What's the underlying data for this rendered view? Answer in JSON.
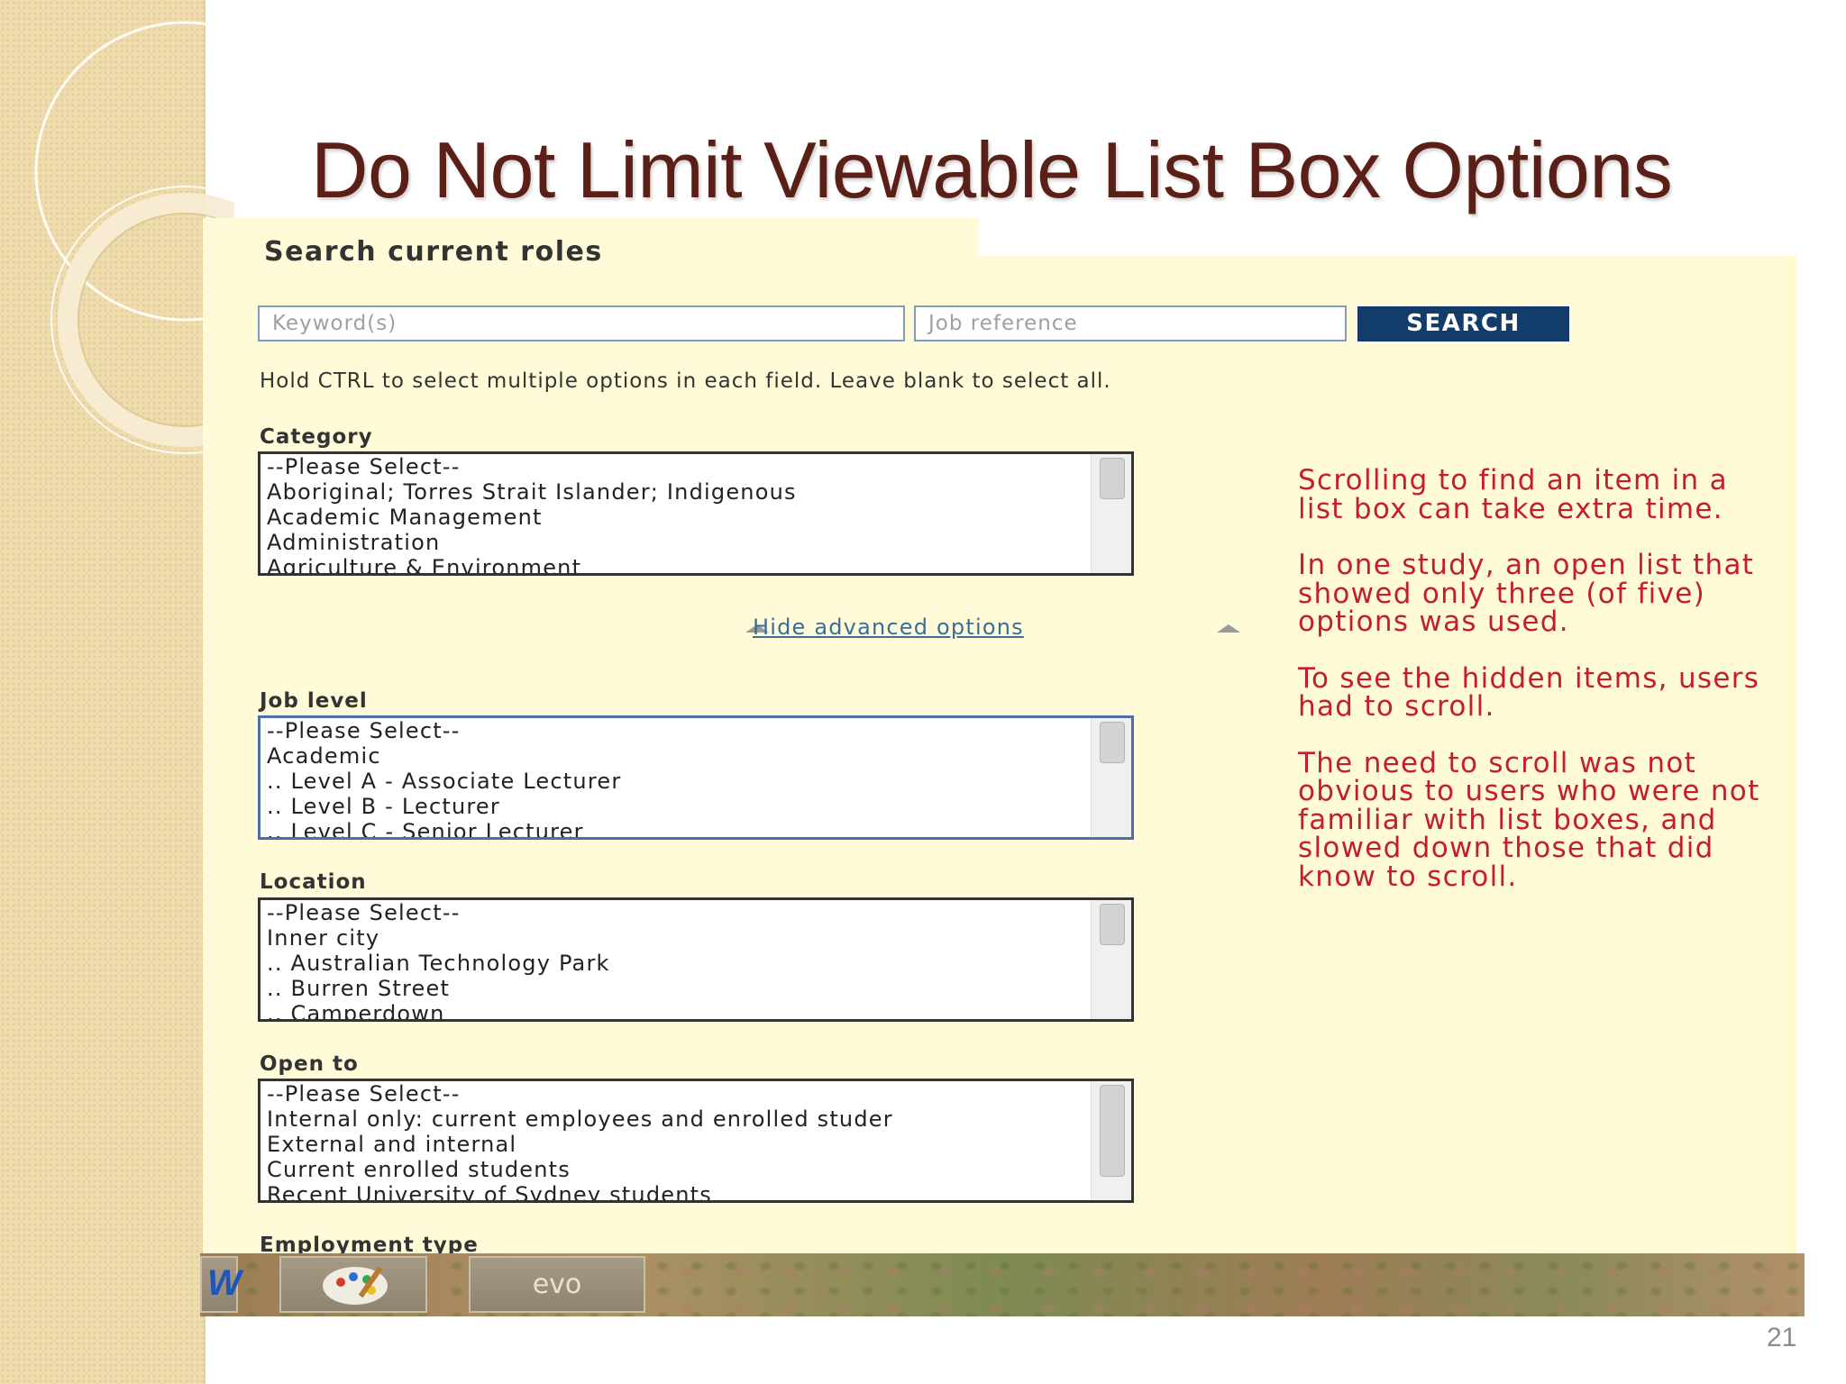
{
  "slide": {
    "title": "Do Not Limit Viewable List Box Options",
    "page_number": "21"
  },
  "form": {
    "heading": "Search current roles",
    "keyword_placeholder": "Keyword(s)",
    "job_reference_placeholder": "Job reference",
    "search_button_label": "SEARCH",
    "hint": "Hold CTRL to select multiple options in each field. Leave blank to select all.",
    "hide_advanced_label": "Hide advanced options",
    "fields": {
      "category": {
        "label": "Category",
        "options": [
          "--Please Select--",
          "Aboriginal; Torres Strait Islander; Indigenous",
          "Academic Management",
          "Administration",
          "Agriculture & Environment"
        ]
      },
      "job_level": {
        "label": "Job level",
        "options": [
          "--Please Select--",
          "Academic",
          ".. Level A - Associate Lecturer",
          ".. Level B - Lecturer",
          ".. Level C - Senior Lecturer"
        ]
      },
      "location": {
        "label": "Location",
        "options": [
          "--Please Select--",
          "Inner city",
          ".. Australian Technology Park",
          ".. Burren Street",
          ".. Camperdown"
        ]
      },
      "open_to": {
        "label": "Open to",
        "options": [
          "--Please Select--",
          "Internal only: current employees and enrolled studer",
          "External and internal",
          "Current enrolled students",
          "Recent University of Sydney students"
        ]
      },
      "employment_type": {
        "label": "Employment type"
      }
    }
  },
  "annotation": {
    "paragraphs": [
      "Scrolling to find an item in a list box can take extra time.",
      " In one study, an open list that showed only three (of five) options was used.",
      "To see the hidden items, users had to scroll.",
      "The need to scroll was not obvious to users who were not familiar with list boxes, and slowed down those that did know to scroll."
    ]
  },
  "taskbar": {
    "evo_label": "evo",
    "word_glyph": "W",
    "icons": [
      "word-icon",
      "paint-icon",
      "evo-icon"
    ]
  },
  "colors": {
    "title": "#5a1f16",
    "annotation": "#c41e2c",
    "panel_background": "#fffbd9",
    "search_button": "#123d6b",
    "link": "#3a6e99"
  }
}
